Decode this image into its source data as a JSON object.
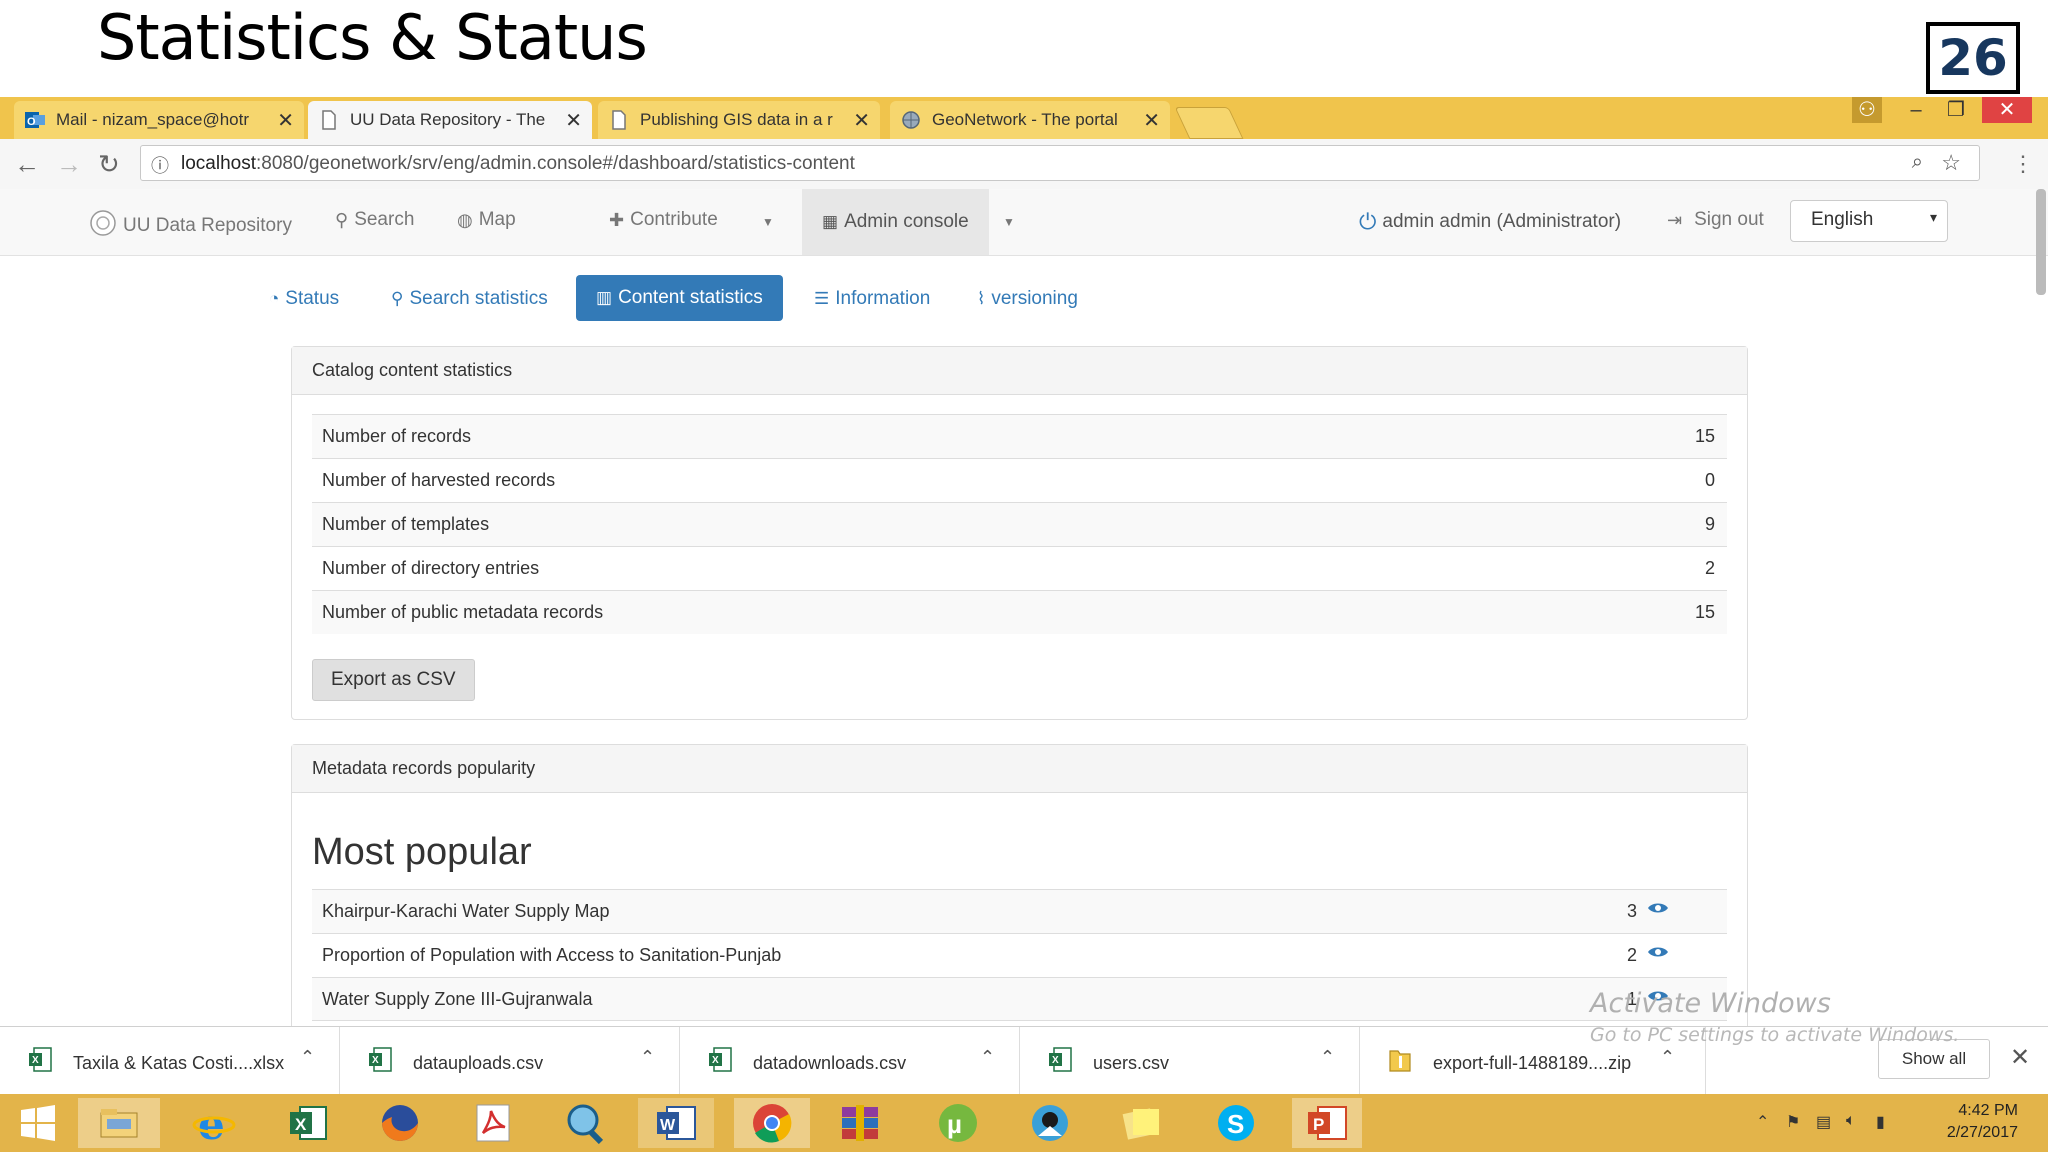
{
  "slide": {
    "title": "Statistics & Status",
    "number": "26"
  },
  "browser": {
    "tabs": [
      {
        "label": "Mail - nizam_space@hotr",
        "icon": "outlook-icon"
      },
      {
        "label": "UU Data Repository - The",
        "icon": "page-icon"
      },
      {
        "label": "Publishing GIS data in a r",
        "icon": "page-icon"
      },
      {
        "label": "GeoNetwork - The portal",
        "icon": "geonetwork-icon"
      }
    ],
    "url_host": "localhost",
    "url_rest": ":8080/geonetwork/srv/eng/admin.console#/dashboard/statistics-content"
  },
  "navbar": {
    "brand": "UU Data Repository",
    "search": "Search",
    "map": "Map",
    "contribute": "Contribute",
    "admin_console": "Admin console",
    "user": "admin admin (Administrator)",
    "sign_out": "Sign out",
    "language": "English"
  },
  "subtabs": {
    "status": "Status",
    "search_statistics": "Search statistics",
    "content_statistics": "Content statistics",
    "information": "Information",
    "versioning": "versioning"
  },
  "catalog_panel": {
    "title": "Catalog content statistics",
    "rows": [
      {
        "label": "Number of records",
        "value": "15"
      },
      {
        "label": "Number of harvested records",
        "value": "0"
      },
      {
        "label": "Number of templates",
        "value": "9"
      },
      {
        "label": "Number of directory entries",
        "value": "2"
      },
      {
        "label": "Number of public metadata records",
        "value": "15"
      }
    ],
    "export_label": "Export as CSV"
  },
  "popularity_panel": {
    "title": "Metadata records popularity",
    "heading": "Most popular",
    "rows": [
      {
        "label": "Khairpur-Karachi Water Supply Map",
        "value": "3"
      },
      {
        "label": "Proportion of Population with Access to Sanitation-Punjab",
        "value": "2"
      },
      {
        "label": "Water Supply Zone III-Gujranwala",
        "value": "1"
      }
    ]
  },
  "watermark": {
    "line1": "Activate Windows",
    "line2": "Go to PC settings to activate Windows."
  },
  "downloads": {
    "items": [
      {
        "name": "Taxila & Katas Costi....xlsx",
        "icon": "excel-file-icon"
      },
      {
        "name": "datauploads.csv",
        "icon": "excel-file-icon"
      },
      {
        "name": "datadownloads.csv",
        "icon": "excel-file-icon"
      },
      {
        "name": "users.csv",
        "icon": "excel-file-icon"
      },
      {
        "name": "export-full-1488189....zip",
        "icon": "zip-file-icon"
      }
    ],
    "show_all": "Show all"
  },
  "taskbar": {
    "time": "4:42 PM",
    "date": "2/27/2017"
  },
  "colors": {
    "link": "#337ab7",
    "active_tab": "#337ab7",
    "browser_tabbar": "#f0c44c",
    "taskbar": "#e3b44a"
  }
}
